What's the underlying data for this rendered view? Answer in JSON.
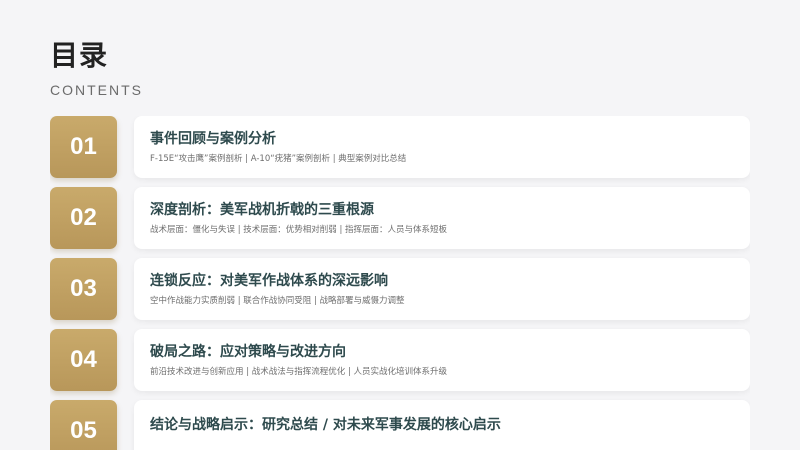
{
  "header": {
    "title": "目录",
    "subtitle": "CONTENTS"
  },
  "toc": {
    "items": [
      {
        "number": "01",
        "title": "事件回顾与案例分析",
        "description": "F-15E“攻击鹰”案例剖析 | A-10“疣猪”案例剖析 | 典型案例对比总结"
      },
      {
        "number": "02",
        "title": "深度剖析：美军战机折戟的三重根源",
        "description": "战术层面：僵化与失误 | 技术层面：优势相对削弱 | 指挥层面：人员与体系短板"
      },
      {
        "number": "03",
        "title": "连锁反应：对美军作战体系的深远影响",
        "description": "空中作战能力实质削弱 | 联合作战协同受阻 | 战略部署与威慑力调整"
      },
      {
        "number": "04",
        "title": "破局之路：应对策略与改进方向",
        "description": "前沿技术改进与创新应用 | 战术战法与指挥流程优化 | 人员实战化培训体系升级"
      },
      {
        "number": "05",
        "title": "结论与战略启示：研究总结 / 对未来军事发展的核心启示",
        "description": ""
      }
    ]
  },
  "colors": {
    "accent_gold": "#c2a265",
    "title_teal": "#2e4a4d",
    "background": "#f5f5f7"
  }
}
